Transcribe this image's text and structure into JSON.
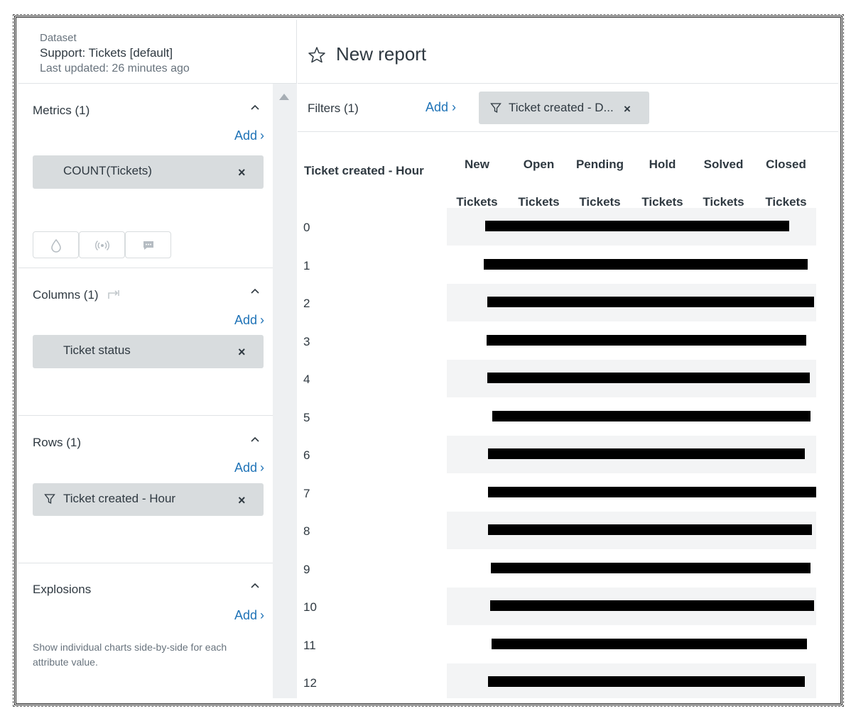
{
  "dataset": {
    "label": "Dataset",
    "name": "Support: Tickets [default]",
    "updated": "Last updated: 26 minutes ago"
  },
  "metrics": {
    "title": "Metrics (1)",
    "add": "Add",
    "items": [
      "COUNT(Tickets)"
    ]
  },
  "columns": {
    "title": "Columns (1)",
    "add": "Add",
    "items": [
      "Ticket status"
    ]
  },
  "rows": {
    "title": "Rows (1)",
    "add": "Add",
    "items": [
      "Ticket created - Hour"
    ]
  },
  "explosions": {
    "title": "Explosions",
    "add": "Add",
    "description": "Show individual charts side-by-side for each attribute value."
  },
  "viz_buttons": [
    "drop-icon",
    "broadcast-icon",
    "chat-icon"
  ],
  "report": {
    "title": "New report"
  },
  "filters": {
    "label": "Filters (1)",
    "add": "Add",
    "items": [
      "Ticket created - D..."
    ]
  },
  "table": {
    "row_header": "Ticket created - Hour",
    "columns": [
      {
        "line1": "New",
        "line2": "Tickets"
      },
      {
        "line1": "Open",
        "line2": "Tickets"
      },
      {
        "line1": "Pending",
        "line2": "Tickets"
      },
      {
        "line1": "Hold",
        "line2": "Tickets"
      },
      {
        "line1": "Solved",
        "line2": "Tickets"
      },
      {
        "line1": "Closed",
        "line2": "Tickets"
      }
    ],
    "rows": [
      "0",
      "1",
      "2",
      "3",
      "4",
      "5",
      "6",
      "7",
      "8",
      "9",
      "10",
      "11",
      "12"
    ]
  },
  "colors": {
    "accent": "#1f73b7",
    "pill": "#d8dcde",
    "text": "#2f3941",
    "muted": "#68737d"
  }
}
